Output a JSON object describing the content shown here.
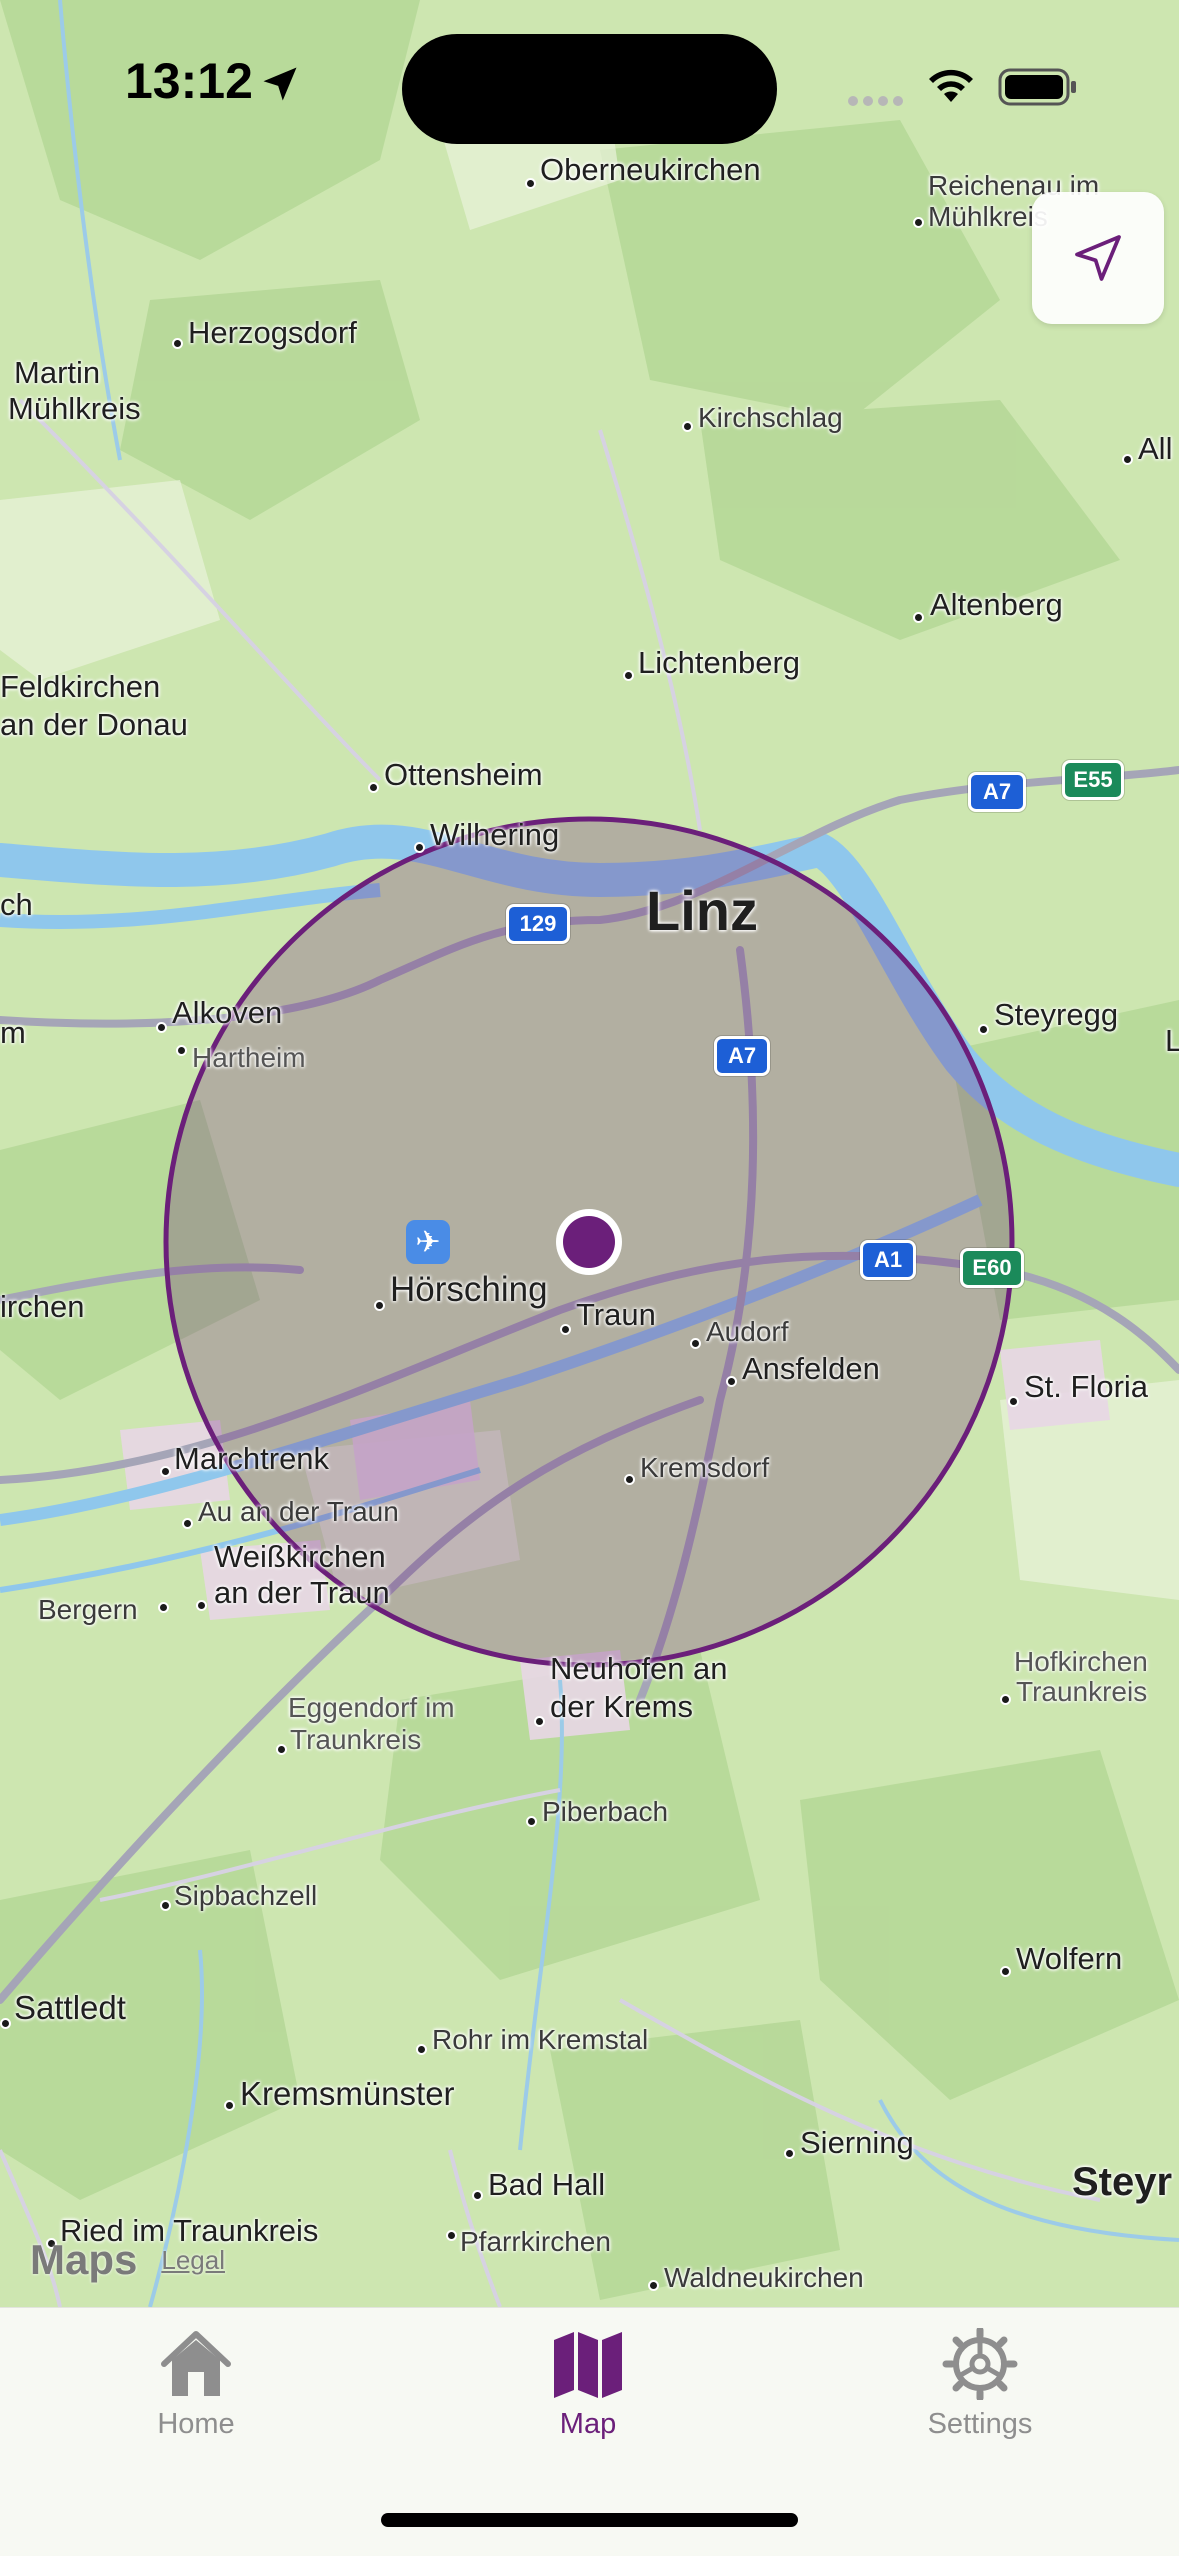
{
  "status_bar": {
    "time": "13:12"
  },
  "map": {
    "places": {
      "oberneukirchen": "Oberneukirchen",
      "reichenau": "Reichenau im Mühlkreis",
      "herzogsdorf": "Herzogsdorf",
      "martin": "Martin",
      "muhlkreis": "Mühlkreis",
      "kirchschlag": "Kirchschlag",
      "all": "All",
      "altenberg": "Altenberg",
      "lichtenberg": "Lichtenberg",
      "feldkirchen1": "Feldkirchen",
      "feldkirchen2": "an der Donau",
      "ottensheim": "Ottensheim",
      "wilhering": "Wilhering",
      "linz": "Linz",
      "ch": "ch",
      "m": "m",
      "alkoven": "Alkoven",
      "hartheim": "Hartheim",
      "steyregg": "Steyregg",
      "l": "L",
      "hoersching": "Hörsching",
      "traun": "Traun",
      "audorf": "Audorf",
      "ansfelden": "Ansfelden",
      "irchen": "irchen",
      "st_florian": "St. Floria",
      "marchtrenk": "Marchtrenk",
      "kremsdorf": "Kremsdorf",
      "au": "Au an der Traun",
      "weisskirchen1": "Weißkirchen",
      "weisskirchen2": "an der Traun",
      "bergern": "Bergern",
      "neuhofen1": "Neuhofen an",
      "neuhofen2": "der Krems",
      "eggendorf1": "Eggendorf im",
      "eggendorf2": "Traunkreis",
      "hofkirchen1": "Hofkirchen",
      "hofkirchen2": "Traunkreis",
      "piberbach": "Piberbach",
      "sipbachzell": "Sipbachzell",
      "wolfern": "Wolfern",
      "sattledt": "Sattledt",
      "rohr": "Rohr im Kremstal",
      "kremsmuenster": "Kremsmünster",
      "sierning": "Sierning",
      "steyr": "Steyr",
      "bad_hall": "Bad Hall",
      "ried": "Ried im Traunkreis",
      "pfarrkirchen": "Pfarrkirchen",
      "waldneukirchen": "Waldneukirchen"
    },
    "shields": {
      "a7_north": "A7",
      "e55": "E55",
      "r129": "129",
      "a7_city": "A7",
      "a1": "A1",
      "e60": "E60"
    },
    "radius_color": "#6b1f7a",
    "attribution": {
      "logo": "Maps",
      "legal": "Legal"
    }
  },
  "tabbar": {
    "tabs": [
      {
        "label": "Home",
        "active": false
      },
      {
        "label": "Map",
        "active": true
      },
      {
        "label": "Settings",
        "active": false
      }
    ],
    "accent": "#6b1f7a",
    "inactive": "#8e8e8e"
  }
}
